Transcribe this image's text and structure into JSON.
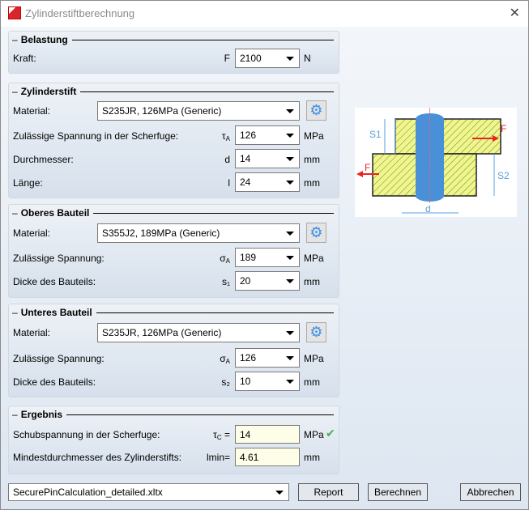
{
  "window": {
    "title": "Zylinderstiftberechnung",
    "close": "✕"
  },
  "belastung": {
    "title": "Belastung",
    "kraft_label": "Kraft:",
    "kraft_symbol": "F",
    "kraft_value": "2100",
    "kraft_unit": "N"
  },
  "zylinderstift": {
    "title": "Zylinderstift",
    "material_label": "Material:",
    "material_value": "S235JR, 126MPa (Generic)",
    "spannung_label": "Zulässige Spannung in der Scherfuge:",
    "spannung_symbol": "τ",
    "spannung_sub": "A",
    "spannung_value": "126",
    "spannung_unit": "MPa",
    "durchmesser_label": "Durchmesser:",
    "durchmesser_symbol": "d",
    "durchmesser_value": "14",
    "durchmesser_unit": "mm",
    "laenge_label": "Länge:",
    "laenge_symbol": "l",
    "laenge_value": "24",
    "laenge_unit": "mm"
  },
  "oberes": {
    "title": "Oberes Bauteil",
    "material_label": "Material:",
    "material_value": "S355J2, 189MPa (Generic)",
    "spannung_label": "Zulässige Spannung:",
    "spannung_symbol": "σ",
    "spannung_sub": "A",
    "spannung_value": "189",
    "spannung_unit": "MPa",
    "dicke_label": "Dicke des Bauteils:",
    "dicke_symbol": "s₁",
    "dicke_value": "20",
    "dicke_unit": "mm"
  },
  "unteres": {
    "title": "Unteres Bauteil",
    "material_label": "Material:",
    "material_value": "S235JR, 126MPa (Generic)",
    "spannung_label": "Zulässige Spannung:",
    "spannung_symbol": "σ",
    "spannung_sub": "A",
    "spannung_value": "126",
    "spannung_unit": "MPa",
    "dicke_label": "Dicke des Bauteils:",
    "dicke_symbol": "s₂",
    "dicke_value": "10",
    "dicke_unit": "mm"
  },
  "ergebnis": {
    "title": "Ergebnis",
    "schub_label": "Schubspannung in der Scherfuge:",
    "schub_symbol": "τ",
    "schub_sub": "C",
    "schub_eq": " =",
    "schub_value": "14",
    "schub_unit": "MPa",
    "mindest_label": "Mindestdurchmesser des Zylinderstifts:",
    "mindest_symbol": "lmin=",
    "mindest_value": "4.61",
    "mindest_unit": "mm"
  },
  "diagram": {
    "s1": "S1",
    "s2": "S2",
    "f": "F",
    "d": "d"
  },
  "footer": {
    "template_value": "SecurePinCalculation_detailed.xltx",
    "report": "Report",
    "berechnen": "Berechnen",
    "abbrechen": "Abbrechen"
  },
  "colors": {
    "accent": "#5aa0e0",
    "ok": "#4caf50"
  }
}
